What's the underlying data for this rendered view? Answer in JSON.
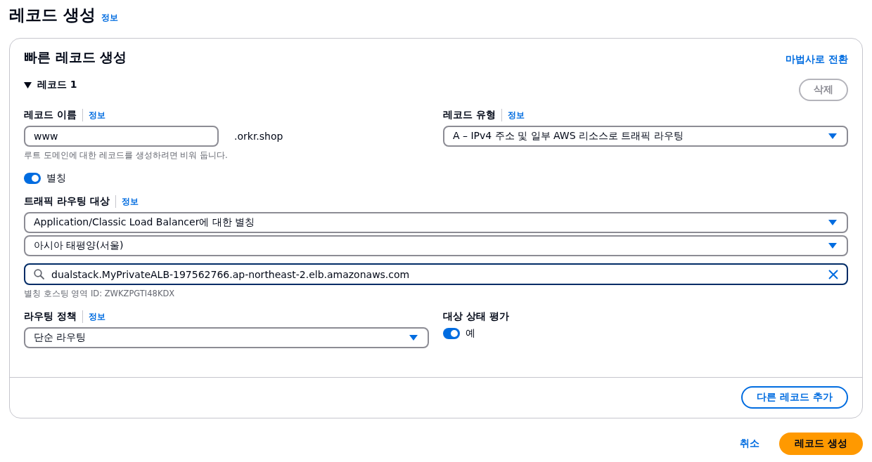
{
  "page": {
    "title": "레코드 생성",
    "info_link": "정보"
  },
  "card": {
    "title": "빠른 레코드 생성",
    "wizard_link": "마법사로 전환",
    "record": {
      "heading": "레코드 1",
      "expanded": true,
      "delete_button": {
        "label": "삭제",
        "disabled": true
      },
      "record_name": {
        "label": "레코드 이름",
        "info": "정보",
        "value": "www",
        "suffix": ".orkr.shop",
        "hint": "루트 도메인에 대한 레코드를 생성하려면 비워 둡니다."
      },
      "record_type": {
        "label": "레코드 유형",
        "info": "정보",
        "value": "A – IPv4 주소 및 일부 AWS 리소스로 트래픽 라우팅"
      },
      "alias": {
        "label": "별칭",
        "on": true
      },
      "route_target": {
        "label": "트래픽 라우팅 대상",
        "info": "정보",
        "endpoint": "Application/Classic Load Balancer에 대한 별칭",
        "region": "아시아 태평양(서울)",
        "search_value": "dualstack.MyPrivateALB-197562766.ap-northeast-2.elb.amazonaws.com",
        "hint": "별칭 호스팅 영역 ID: ZWKZPGTI48KDX"
      },
      "routing_policy": {
        "label": "라우팅 정책",
        "info": "정보",
        "value": "단순 라우팅"
      },
      "health": {
        "label": "대상 상태 평가",
        "toggle_label": "예",
        "on": true
      }
    },
    "add_button": "다른 레코드 추가"
  },
  "footer": {
    "cancel": "취소",
    "submit": "레코드 생성"
  }
}
